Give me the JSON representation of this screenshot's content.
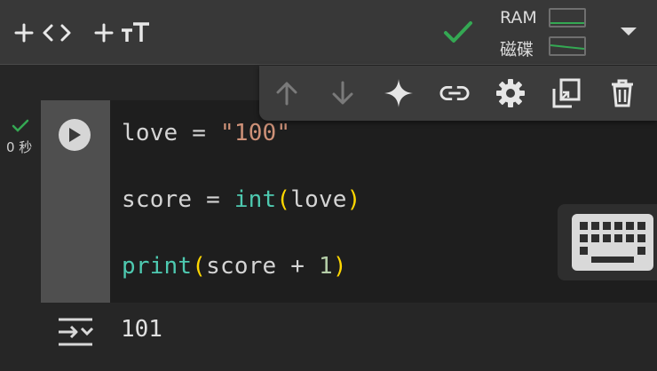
{
  "toolbar": {
    "add_code": "+ <>",
    "add_text": "+ тT",
    "ram_label": "RAM",
    "disk_label": "磁碟",
    "ram_usage": 0.05,
    "disk_usage": 0.3,
    "status": "connected"
  },
  "cell_toolbar": {
    "icons": [
      "arrow-up-icon",
      "arrow-down-icon",
      "sparkle-icon",
      "link-icon",
      "gear-icon",
      "mirror-cell-icon",
      "trash-icon"
    ]
  },
  "cell": {
    "exec_time": "0 秒",
    "code": [
      {
        "parts": [
          {
            "t": "love = ",
            "c": ""
          },
          {
            "t": "\"100\"",
            "c": "str"
          }
        ]
      },
      {
        "parts": [
          {
            "t": "score = ",
            "c": ""
          },
          {
            "t": "int",
            "c": "fn"
          },
          {
            "t": "(",
            "c": "p1"
          },
          {
            "t": "love",
            "c": ""
          },
          {
            "t": ")",
            "c": "p1"
          }
        ]
      },
      {
        "parts": [
          {
            "t": "print",
            "c": "fn"
          },
          {
            "t": "(",
            "c": "p1"
          },
          {
            "t": "score + ",
            "c": ""
          },
          {
            "t": "1",
            "c": "num"
          },
          {
            "t": ")",
            "c": "p1"
          }
        ]
      }
    ],
    "output": "101"
  },
  "colors": {
    "accent_green": "#34a853",
    "string": "#ce9178",
    "function": "#4ec9b0",
    "number": "#b5cea8",
    "paren": "#ffd700"
  }
}
